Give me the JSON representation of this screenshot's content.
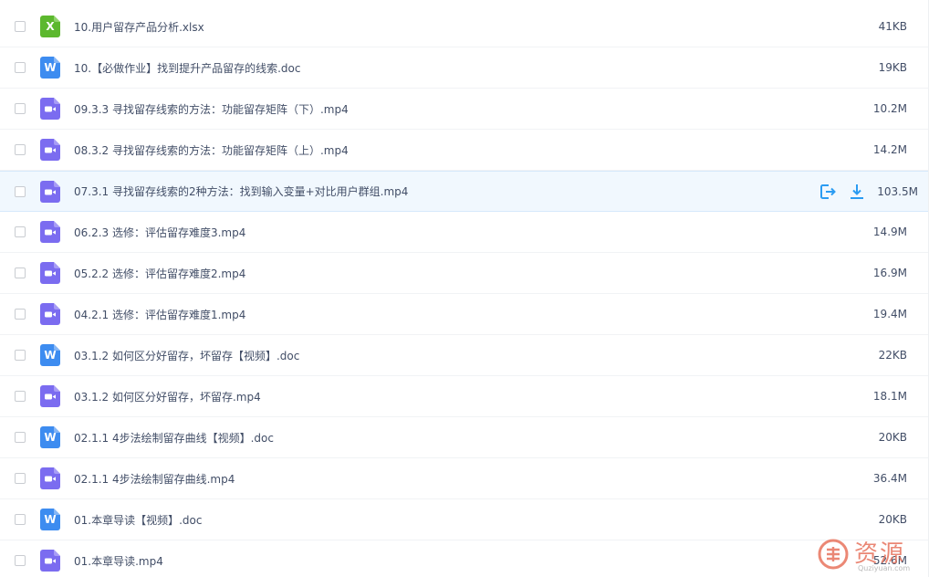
{
  "files": [
    {
      "name": "10.用户留存产品分析.xlsx",
      "size": "41KB",
      "type": "xlsx",
      "icon": "excel-file-icon",
      "icon_letter": "X"
    },
    {
      "name": "10.【必做作业】找到提升产品留存的线索.doc",
      "size": "19KB",
      "type": "doc",
      "icon": "word-file-icon",
      "icon_letter": "W"
    },
    {
      "name": "09.3.3 寻找留存线索的方法：功能留存矩阵（下）.mp4",
      "size": "10.2M",
      "type": "mp4",
      "icon": "video-file-icon"
    },
    {
      "name": "08.3.2 寻找留存线索的方法：功能留存矩阵（上）.mp4",
      "size": "14.2M",
      "type": "mp4",
      "icon": "video-file-icon"
    },
    {
      "name": "07.3.1 寻找留存线索的2种方法：找到输入变量+对比用户群组.mp4",
      "size": "103.5M",
      "type": "mp4",
      "icon": "video-file-icon",
      "hover": true
    },
    {
      "name": "06.2.3 选修：评估留存难度3.mp4",
      "size": "14.9M",
      "type": "mp4",
      "icon": "video-file-icon"
    },
    {
      "name": "05.2.2 选修：评估留存难度2.mp4",
      "size": "16.9M",
      "type": "mp4",
      "icon": "video-file-icon"
    },
    {
      "name": "04.2.1 选修：评估留存难度1.mp4",
      "size": "19.4M",
      "type": "mp4",
      "icon": "video-file-icon"
    },
    {
      "name": "03.1.2 如何区分好留存，坏留存【视频】.doc",
      "size": "22KB",
      "type": "doc",
      "icon": "word-file-icon",
      "icon_letter": "W"
    },
    {
      "name": "03.1.2 如何区分好留存，坏留存.mp4",
      "size": "18.1M",
      "type": "mp4",
      "icon": "video-file-icon"
    },
    {
      "name": "02.1.1 4步法绘制留存曲线【视频】.doc",
      "size": "20KB",
      "type": "doc",
      "icon": "word-file-icon",
      "icon_letter": "W"
    },
    {
      "name": "02.1.1 4步法绘制留存曲线.mp4",
      "size": "36.4M",
      "type": "mp4",
      "icon": "video-file-icon"
    },
    {
      "name": "01.本章导读【视频】.doc",
      "size": "20KB",
      "type": "doc",
      "icon": "word-file-icon",
      "icon_letter": "W"
    },
    {
      "name": "01.本章导读.mp4",
      "size": "52.6M",
      "type": "mp4",
      "icon": "video-file-icon"
    }
  ],
  "row_actions": {
    "share_icon": "share-icon",
    "download_icon": "download-icon"
  },
  "watermark": {
    "text": "资源",
    "subtext": "Quziyuan.com",
    "logo_icon": "qu-logo-icon"
  },
  "colors": {
    "excel": "#5cb82e",
    "word": "#3d8cf0",
    "video": "#7b6cf0",
    "action": "#2b9cf2",
    "hover_bg": "#f1f8fe",
    "text": "#424e67",
    "watermark": "#e7735d"
  }
}
